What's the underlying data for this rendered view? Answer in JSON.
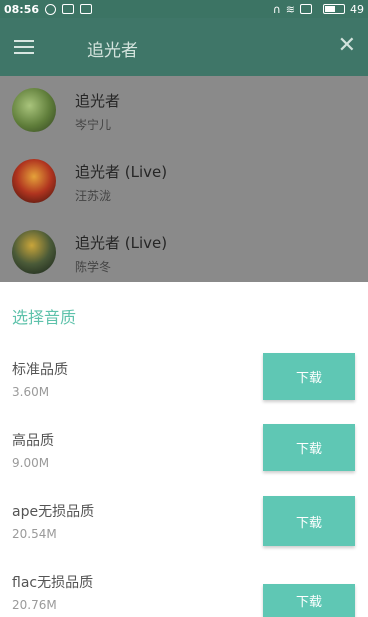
{
  "status_bar": {
    "time": "08:56",
    "battery": "49"
  },
  "toolbar": {
    "menu_icon": "hamburger-menu-icon",
    "title": "追光者",
    "close_icon": "close-icon"
  },
  "songs": [
    {
      "title": "追光者",
      "artist": "岑宁儿"
    },
    {
      "title": "追光者 (Live)",
      "artist": "汪苏泷"
    },
    {
      "title": "追光者 (Live)",
      "artist": "陈学冬"
    }
  ],
  "quality_sheet": {
    "title": "选择音质",
    "options": [
      {
        "name": "标准品质",
        "size": "3.60M",
        "button": "下载"
      },
      {
        "name": "高品质",
        "size": "9.00M",
        "button": "下载"
      },
      {
        "name": "ape无损品质",
        "size": "20.54M",
        "button": "下载"
      },
      {
        "name": "flac无损品质",
        "size": "20.76M",
        "button": "下载"
      }
    ]
  },
  "colors": {
    "toolbar": "#3f7668",
    "accent": "#5ec2ab",
    "button": "#5fc7b4"
  }
}
